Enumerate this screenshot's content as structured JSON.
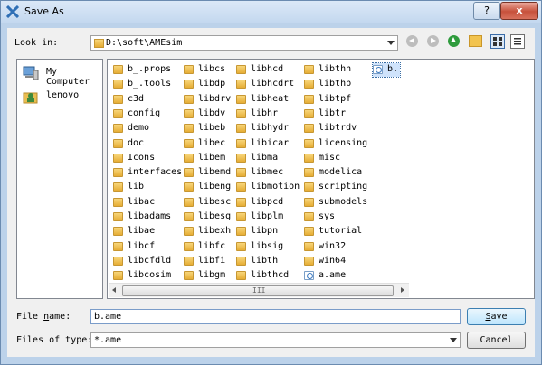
{
  "window": {
    "title": "Save As",
    "help_label": "?",
    "close_label": "x"
  },
  "look_in": {
    "label": "Look in:",
    "value": "D:\\soft\\AMEsim"
  },
  "nav": {
    "back": "back-icon",
    "forward": "forward-icon",
    "up": "up-folder-icon",
    "new_folder": "new-folder-icon"
  },
  "places": [
    {
      "label": "My Computer",
      "icon": "computer-icon"
    },
    {
      "label": "lenovo",
      "icon": "user-folder-icon"
    }
  ],
  "files": {
    "col1": [
      "b_.props",
      "b_.tools",
      "c3d",
      "config",
      "demo",
      "doc",
      "Icons",
      "interfaces",
      "lib",
      "libac",
      "libadams",
      "libae",
      "libcf",
      "libcfdld",
      "libcosim"
    ],
    "col2": [
      "libcs",
      "libdp",
      "libdrv",
      "libdv",
      "libeb",
      "libec",
      "libem",
      "libemd",
      "libeng",
      "libesc",
      "libesg",
      "libexh",
      "libfc",
      "libfi",
      "libgm"
    ],
    "col3": [
      "libhcd",
      "libhcdrt",
      "libheat",
      "libhr",
      "libhydr",
      "libicar",
      "libma",
      "libmec",
      "libmotion",
      "libpcd",
      "libplm",
      "libpn",
      "libsig",
      "libth",
      "libthcd"
    ],
    "col4": [
      "libthh",
      "libthp",
      "libtpf",
      "libtr",
      "libtrdv",
      "licensing",
      "misc",
      "modelica",
      "scripting",
      "submodels",
      "sys",
      "tutorial",
      "win32",
      "win64",
      "a.ame"
    ],
    "col5": [
      "b."
    ]
  },
  "hscroll": {
    "grip": "III"
  },
  "file_name": {
    "label": "File name:",
    "value": "b.ame"
  },
  "file_type": {
    "label": "Files of type:",
    "value": "*.ame"
  },
  "buttons": {
    "save": "Save",
    "cancel": "Cancel"
  }
}
